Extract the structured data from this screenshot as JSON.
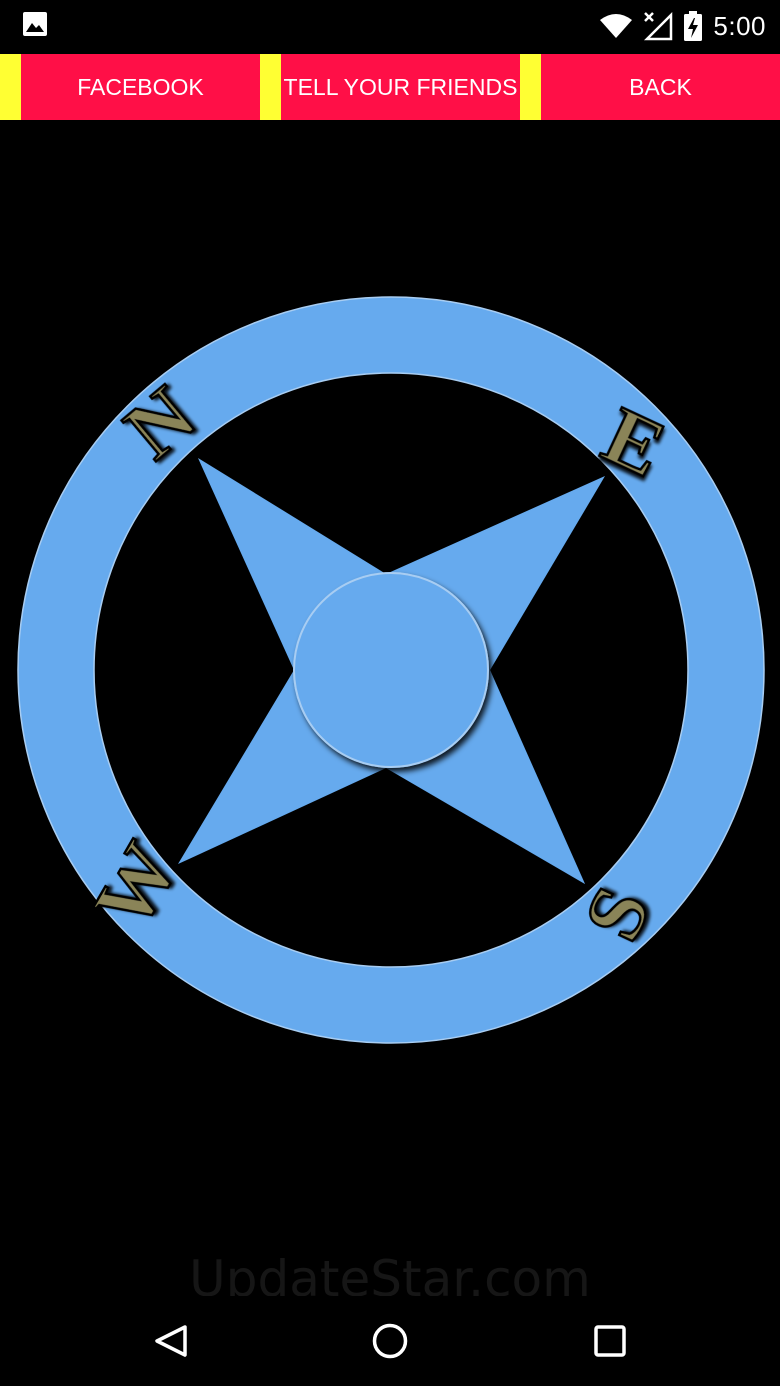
{
  "status_bar": {
    "time": "5:00",
    "icons": [
      "gallery-notification-icon",
      "wifi-icon",
      "no-signal-icon",
      "battery-charging-icon"
    ]
  },
  "top_bar": {
    "facebook_label": "FACEBOOK",
    "tell_friends_label": "TELL YOUR FRIENDS",
    "back_label": "BACK"
  },
  "compass": {
    "north": "N",
    "east": "E",
    "south": "S",
    "west": "W"
  },
  "watermark": "UpdateStar.com",
  "nav_bar": {
    "icons": [
      "back-triangle-icon",
      "home-circle-icon",
      "recents-square-icon"
    ]
  },
  "colors": {
    "button_red": "#ff0f47",
    "bar_yellow": "#ffff33",
    "compass_blue": "#66aaee",
    "letter_fill": "#8a8458",
    "background": "#000000"
  }
}
